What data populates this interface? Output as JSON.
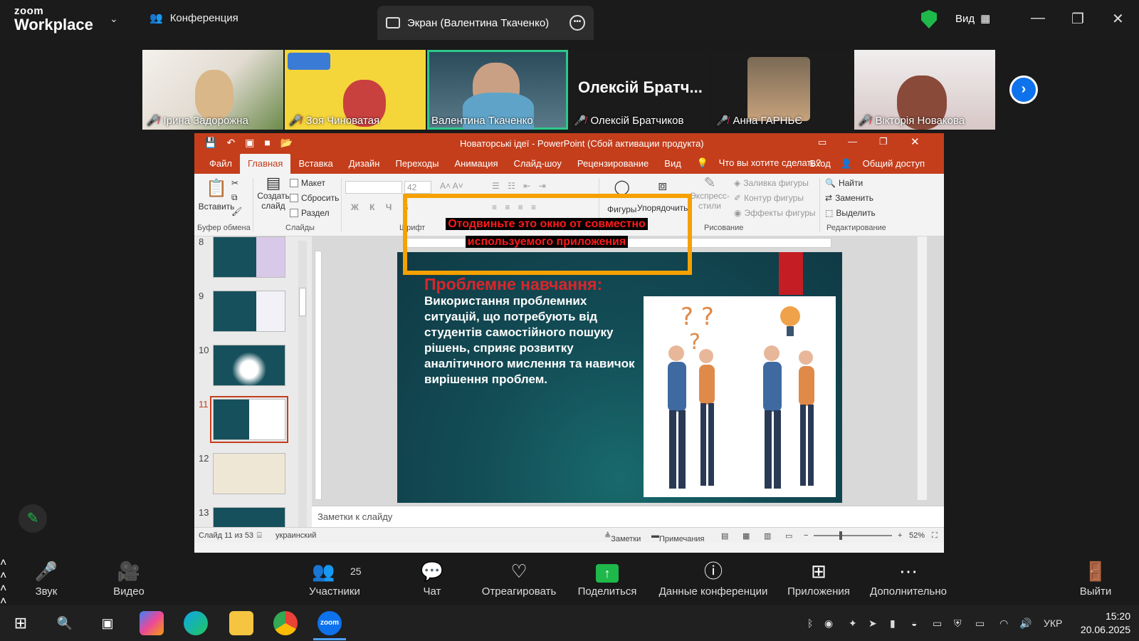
{
  "zoom": {
    "logo_top": "zoom",
    "logo_bottom": "Workplace",
    "conference_tab": "Конференция",
    "screen_tab": "Экран (Валентина Ткаченко)",
    "view_button": "Вид",
    "security_color": "#1fb84a"
  },
  "participants": [
    {
      "name": "Ірина Задорожна",
      "muted": true
    },
    {
      "name": "Зоя Чиноватая",
      "muted": true
    },
    {
      "name": "Валентина Ткаченко",
      "muted": false,
      "active": true
    },
    {
      "name": "Олексій Братчиков",
      "muted": true,
      "big_label": "Олексій Братч..."
    },
    {
      "name": "Анна ГАРНЬЄ",
      "muted": true
    },
    {
      "name": "Вікторія Новакова",
      "muted": true
    }
  ],
  "ppt": {
    "title": "Новаторські ідеї - PowerPoint (Сбой активации продукта)",
    "tabs": [
      "Файл",
      "Главная",
      "Вставка",
      "Дизайн",
      "Переходы",
      "Анимация",
      "Слайд-шоу",
      "Рецензирование",
      "Вид"
    ],
    "search_placeholder": "Что вы хотите сделать?",
    "login": "Вход",
    "share": "Общий доступ",
    "ribbon": {
      "paste": "Вставить",
      "clipboard": "Буфер обмена",
      "create_slide": "Создать слайд",
      "layout": "Макет",
      "reset": "Сбросить",
      "section": "Раздел",
      "slides": "Слайды",
      "font_size": "42",
      "font_group": "Шрифт",
      "shapes": "Фигуры",
      "arrange": "Упорядочить",
      "express": "Экспресс-стили",
      "fill": "Заливка фигуры",
      "outline": "Контур фигуры",
      "effects": "Эффекты фигуры",
      "drawing": "Рисование",
      "find": "Найти",
      "replace": "Заменить",
      "select": "Выделить",
      "editing": "Редактирование"
    },
    "thumb_numbers": [
      "8",
      "9",
      "10",
      "11",
      "12",
      "13"
    ],
    "slide": {
      "heading": "Проблемне навчання:",
      "body": "Використання проблемних ситуацій, що потребують від студентів самостійного пошуку рішень, сприяє розвитку аналітичного мислення та навичок вирішення проблем."
    },
    "notes_placeholder": "Заметки к слайду",
    "status": {
      "slide_counter": "Слайд 11 из 53",
      "language": "украинский",
      "notes": "Заметки",
      "comments": "Примечания",
      "zoom": "52%"
    }
  },
  "warning": "Отодвиньте это окно от совместно используемого приложения",
  "toolbar": {
    "audio": "Звук",
    "video": "Видео",
    "participants": "Участники",
    "participant_count": "25",
    "chat": "Чат",
    "react": "Отреагировать",
    "share": "Поделиться",
    "info": "Данные конференции",
    "apps": "Приложения",
    "more": "Дополнительно",
    "leave": "Выйти"
  },
  "taskbar": {
    "language": "УКР",
    "time": "15:20",
    "date": "20.06.2025"
  }
}
